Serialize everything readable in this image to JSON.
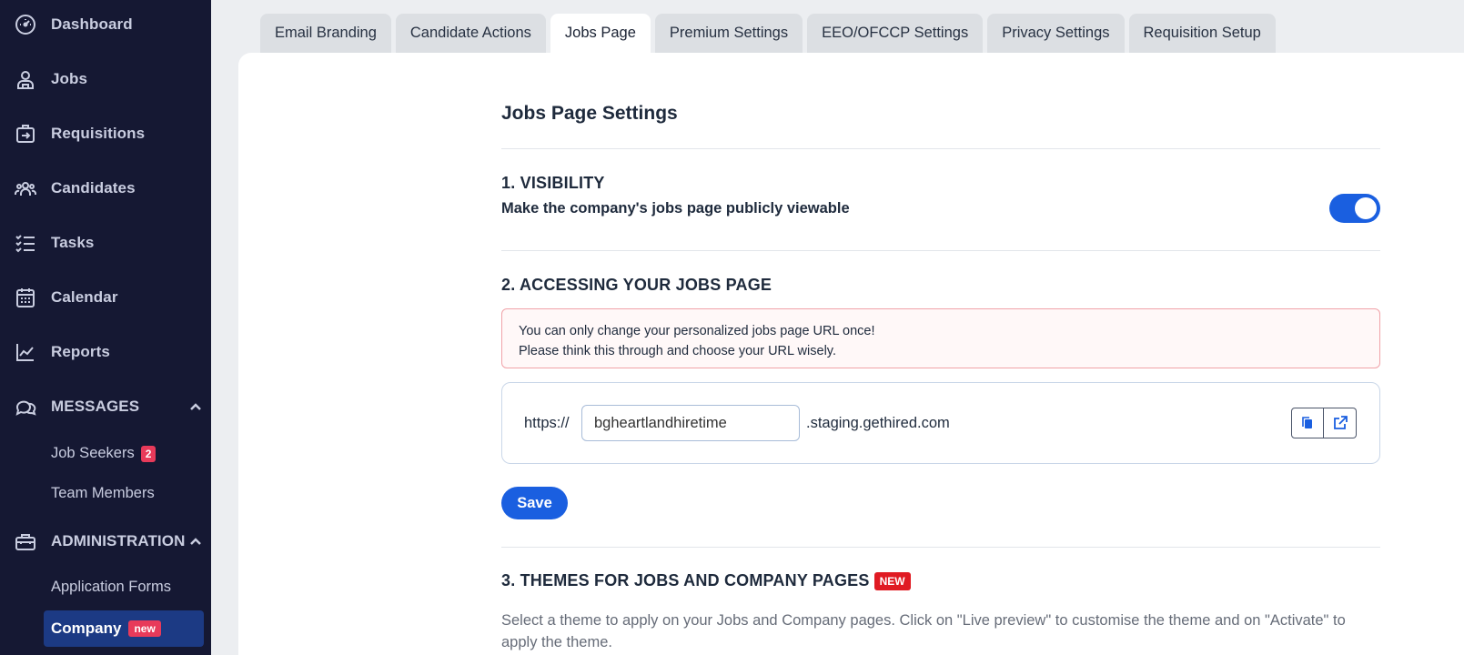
{
  "sidebar": {
    "items": [
      {
        "label": "Dashboard",
        "icon": "dashboard-icon"
      },
      {
        "label": "Jobs",
        "icon": "jobs-icon"
      },
      {
        "label": "Requisitions",
        "icon": "requisitions-icon"
      },
      {
        "label": "Candidates",
        "icon": "candidates-icon"
      },
      {
        "label": "Tasks",
        "icon": "tasks-icon"
      },
      {
        "label": "Calendar",
        "icon": "calendar-icon"
      },
      {
        "label": "Reports",
        "icon": "reports-icon"
      }
    ],
    "messages": {
      "label": "MESSAGES",
      "icon": "messages-icon",
      "sub": [
        {
          "label": "Job Seekers",
          "count": "2"
        },
        {
          "label": "Team Members"
        }
      ]
    },
    "administration": {
      "label": "ADMINISTRATION",
      "icon": "toolbox-icon",
      "sub": [
        {
          "label": "Application Forms"
        },
        {
          "label": "Company",
          "badge": "new"
        }
      ]
    }
  },
  "tabs": [
    {
      "label": "Email Branding",
      "active": false
    },
    {
      "label": "Candidate Actions",
      "active": false
    },
    {
      "label": "Jobs Page",
      "active": true
    },
    {
      "label": "Premium Settings",
      "active": false
    },
    {
      "label": "EEO/OFCCP Settings",
      "active": false
    },
    {
      "label": "Privacy Settings",
      "active": false
    },
    {
      "label": "Requisition Setup",
      "active": false
    }
  ],
  "main": {
    "title": "Jobs Page Settings",
    "visibility": {
      "heading": "1. VISIBILITY",
      "description": "Make the company's jobs page publicly viewable",
      "enabled": true
    },
    "accessing": {
      "heading": "2. ACCESSING YOUR JOBS PAGE",
      "alert_line1": "You can only change your personalized jobs page URL once!",
      "alert_line2": "Please think this through and choose your URL wisely.",
      "url_prefix": "https://",
      "subdomain_value": "bgheartlandhiretime",
      "url_suffix": ".staging.gethired.com",
      "copy_icon": "copy-icon",
      "open_icon": "external-link-icon",
      "save_label": "Save"
    },
    "themes": {
      "heading": "3. THEMES FOR JOBS AND COMPANY PAGES",
      "new_tag": "NEW",
      "description": "Select a theme to apply on your Jobs and Company pages. Click on \"Live preview\" to customise the theme and on \"Activate\" to apply the theme."
    }
  },
  "colors": {
    "sidebar_bg": "#151833",
    "accent": "#1a5fe0",
    "active_sub_bg": "#1c3a84",
    "badge": "#e83a5a",
    "new_tag": "#e01b23"
  }
}
